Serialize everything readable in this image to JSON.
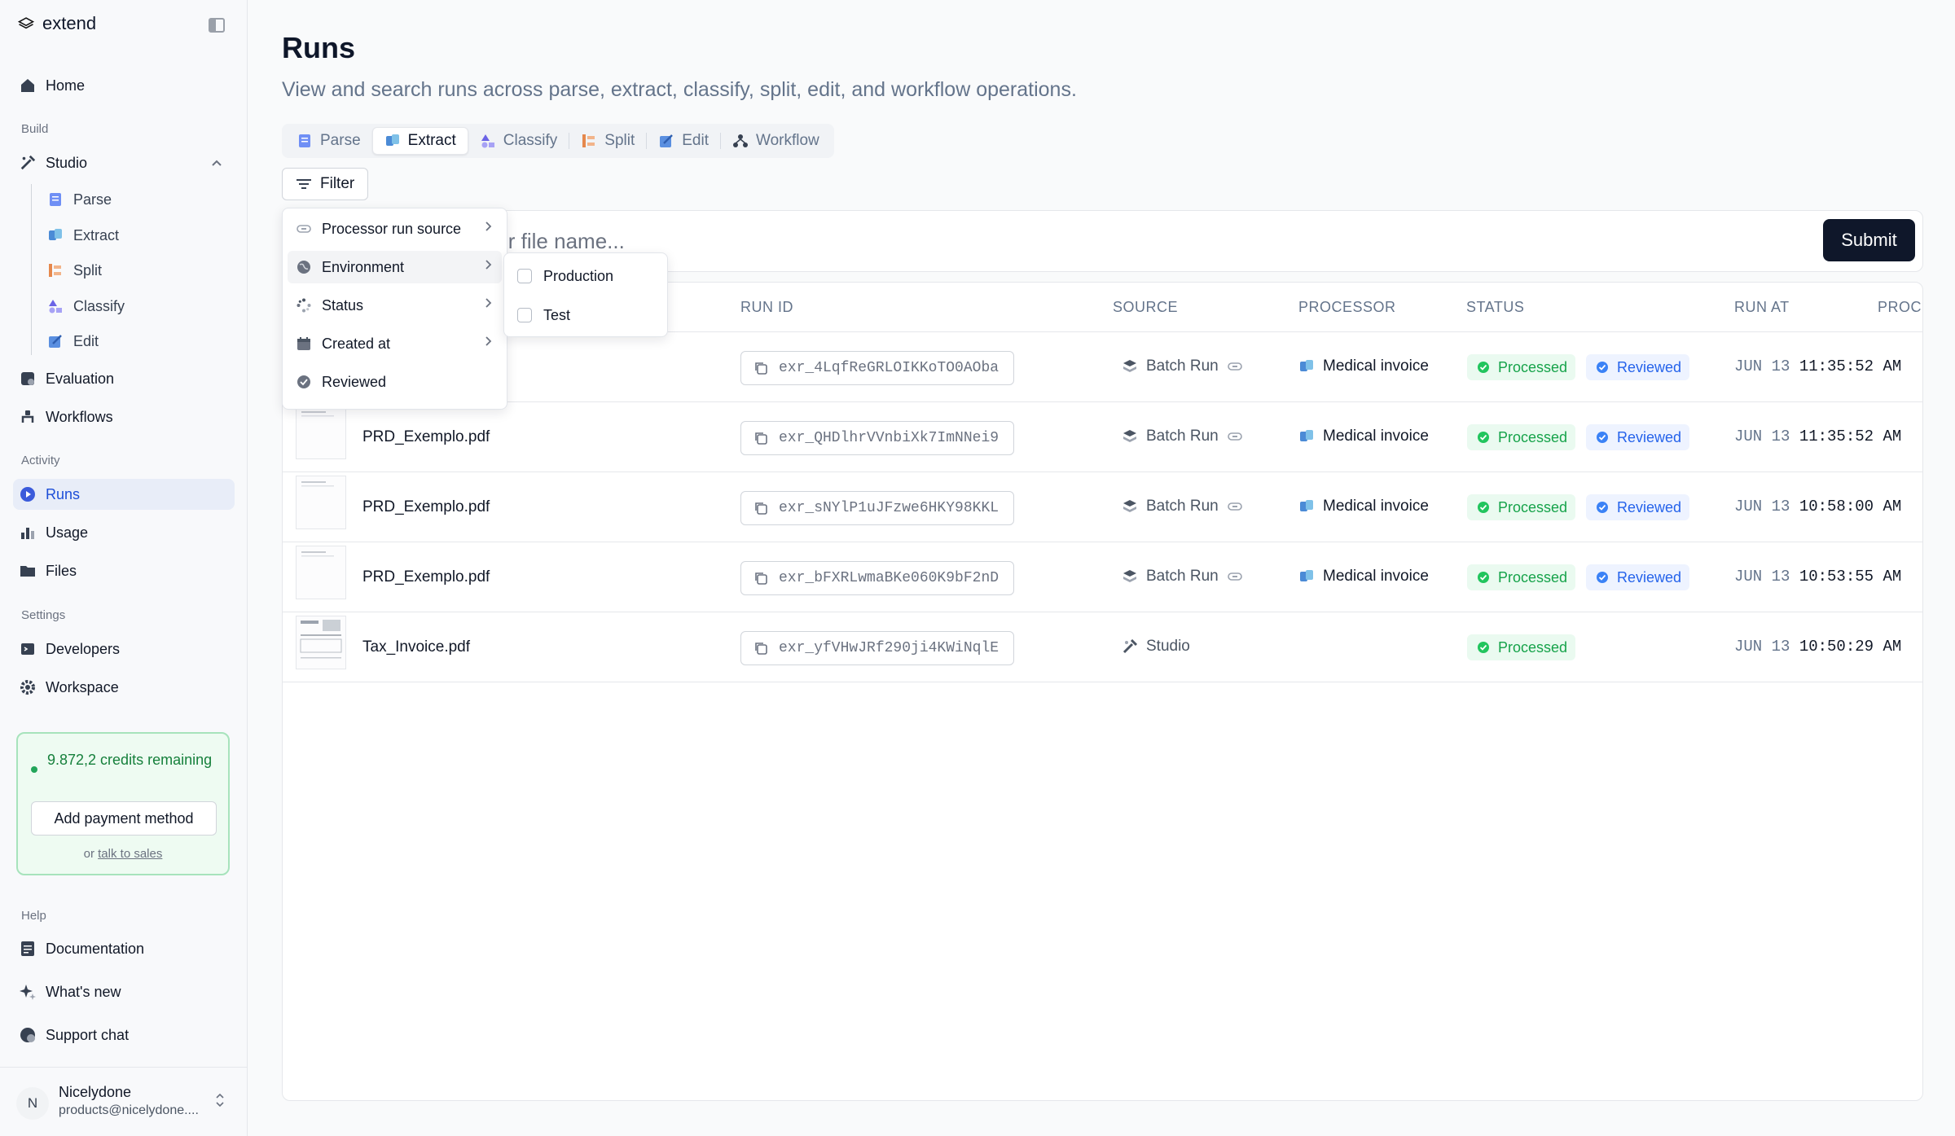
{
  "sidebar": {
    "brand": "extend",
    "nav": {
      "home": "Home",
      "build_label": "Build",
      "studio": "Studio",
      "studio_items": [
        "Parse",
        "Extract",
        "Split",
        "Classify",
        "Edit"
      ],
      "evaluation": "Evaluation",
      "workflows": "Workflows",
      "activity_label": "Activity",
      "runs": "Runs",
      "usage": "Usage",
      "files": "Files",
      "settings_label": "Settings",
      "developers": "Developers",
      "workspace": "Workspace",
      "help_label": "Help",
      "documentation": "Documentation",
      "whats_new": "What's new",
      "support_chat": "Support chat"
    },
    "credits": {
      "text": "9.872,2 credits remaining",
      "button": "Add payment method",
      "or": "or",
      "sales_link": "talk to sales"
    },
    "user": {
      "initial": "N",
      "name": "Nicelydone",
      "email": "products@nicelydone...."
    }
  },
  "main": {
    "title": "Runs",
    "subtitle": "View and search runs across parse, extract, classify, split, edit, and workflow operations.",
    "tabs": [
      "Parse",
      "Extract",
      "Classify",
      "Split",
      "Edit",
      "Workflow"
    ],
    "active_tab": "Extract",
    "filter_label": "Filter",
    "search": {
      "placeholder": "Search by run ID or file name...",
      "submit": "Submit"
    },
    "filter_menu": {
      "items": [
        "Processor run source",
        "Environment",
        "Status",
        "Created at",
        "Reviewed"
      ],
      "submenu": [
        "Production",
        "Test"
      ]
    },
    "table": {
      "headers": [
        "RUN ID",
        "SOURCE",
        "PROCESSOR",
        "STATUS",
        "RUN AT",
        "PROCE"
      ],
      "rows": [
        {
          "file": "",
          "run_id": "exr_4LqfReGRLOIKKoTO0AOba",
          "source": "Batch Run",
          "processor": "Medical invoice",
          "status": "Processed",
          "reviewed": "Reviewed",
          "date": "JUN 13",
          "time": "11:35:52 AM"
        },
        {
          "file": "PRD_Exemplo.pdf",
          "run_id": "exr_QHDlhrVVnbiXk7ImNNei9",
          "source": "Batch Run",
          "processor": "Medical invoice",
          "status": "Processed",
          "reviewed": "Reviewed",
          "date": "JUN 13",
          "time": "11:35:52 AM"
        },
        {
          "file": "PRD_Exemplo.pdf",
          "run_id": "exr_sNYlP1uJFzwe6HKY98KKL",
          "source": "Batch Run",
          "processor": "Medical invoice",
          "status": "Processed",
          "reviewed": "Reviewed",
          "date": "JUN 13",
          "time": "10:58:00 AM"
        },
        {
          "file": "PRD_Exemplo.pdf",
          "run_id": "exr_bFXRLwmaBKe060K9bF2nD",
          "source": "Batch Run",
          "processor": "Medical invoice",
          "status": "Processed",
          "reviewed": "Reviewed",
          "date": "JUN 13",
          "time": "10:53:55 AM"
        },
        {
          "file": "Tax_Invoice.pdf",
          "run_id": "exr_yfVHwJRf290ji4KWiNqlE",
          "source": "Studio",
          "processor": "",
          "status": "Processed",
          "reviewed": "",
          "date": "JUN 13",
          "time": "10:50:29 AM"
        }
      ]
    }
  },
  "colors": {
    "accent": "#2563eb",
    "success": "#16a34a",
    "primary_button": "#0f172a",
    "credits_bg": "#eefbf2"
  }
}
